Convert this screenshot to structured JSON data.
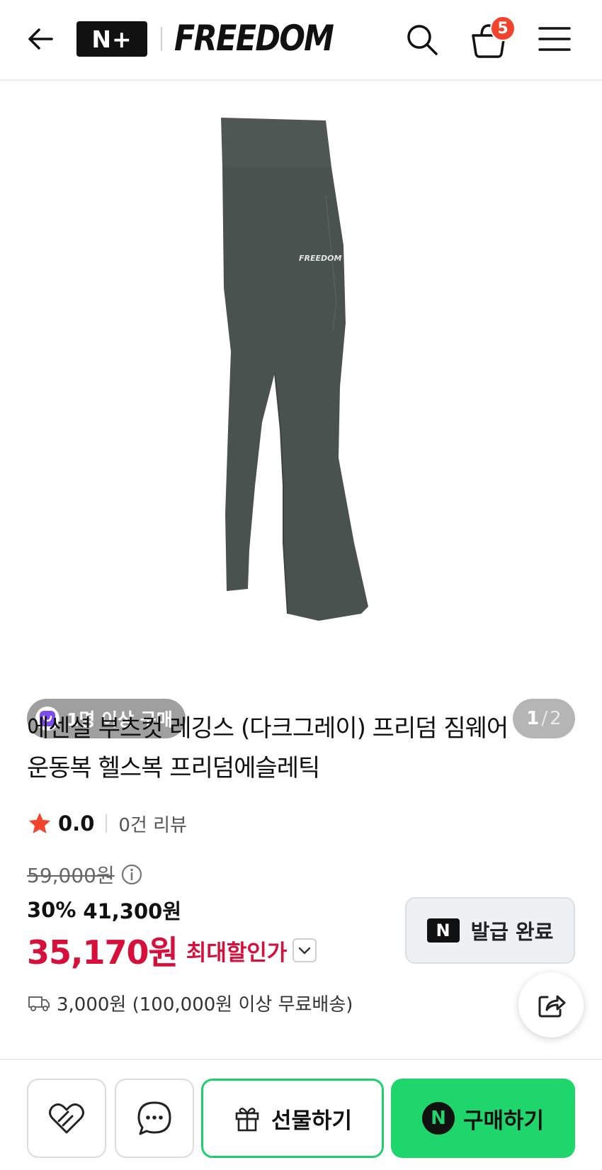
{
  "header": {
    "logo_text": "N+",
    "brand": "FREEDOM",
    "cart_count": "5"
  },
  "gallery": {
    "purchase_chip": "1명 이상 구매",
    "page_current": "1",
    "page_separator": "/",
    "page_total": "2",
    "print_on_product": "FREEDOM"
  },
  "product": {
    "title_line1": "에센셜 부츠컷 레깅스 (다크그레이) 프리덤 짐웨어",
    "title_line2": "운동복 헬스복 프리덤에슬레틱",
    "rating": "0.0",
    "review_count": "0건 리뷰",
    "original_price": "59,000원",
    "discount_rate": "30%",
    "sale_price": "41,300원",
    "max_discount_price": "35,170원",
    "max_discount_label": "최대할인가",
    "shipping": "3,000원 (100,000원 이상 무료배송)"
  },
  "coupon": {
    "badge": "N",
    "label": "발급 완료"
  },
  "actions": {
    "gift_label": "선물하기",
    "buy_badge": "N",
    "buy_label": "구매하기"
  },
  "colors": {
    "accent_red": "#d6103a",
    "naver_green": "#1fd66c",
    "badge_red": "#f2442d",
    "product_gray": "#4a5250"
  }
}
